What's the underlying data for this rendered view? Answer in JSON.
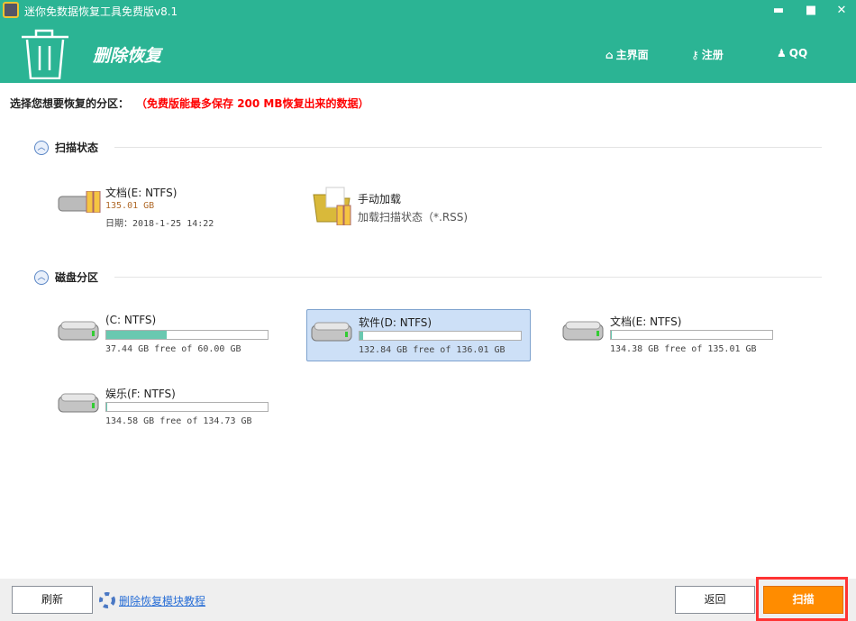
{
  "window": {
    "title": "迷你免数据恢复工具免费版v8.1",
    "minimize": "▬",
    "maximize": "■",
    "close": "✕"
  },
  "header": {
    "module_title": "删除恢复",
    "nav": [
      {
        "icon": "home-icon",
        "glyph": "⌂",
        "label": "主界面"
      },
      {
        "icon": "key-icon",
        "glyph": "⚷",
        "label": "注册"
      },
      {
        "icon": "qq-icon",
        "glyph": "♟",
        "label": "QQ"
      }
    ]
  },
  "prompt": {
    "label": "选择您想要恢复的分区：",
    "notice": "（免费版能最多保存 200 MB恢复出来的数据）"
  },
  "scan_state": {
    "title": "扫描状态",
    "items": [
      {
        "name": "文档(E: NTFS)",
        "size": "135.01 GB",
        "date": "日期：2018-1-25 14:22"
      },
      {
        "name": "手动加载",
        "desc": "加载扫描状态（*.RSS)"
      }
    ]
  },
  "partitions": {
    "title": "磁盘分区",
    "items": [
      {
        "name": "(C: NTFS)",
        "free": "37.44 GB free of 60.00 GB",
        "used_percent": 37.6
      },
      {
        "name": "软件(D: NTFS)",
        "free": "132.84 GB free of 136.01 GB",
        "used_percent": 2.3,
        "selected": true
      },
      {
        "name": "文档(E: NTFS)",
        "free": "134.38 GB free of 135.01 GB",
        "used_percent": 0.5
      },
      {
        "name": "娱乐(F: NTFS)",
        "free": "134.58 GB free of 134.73 GB",
        "used_percent": 0.1
      }
    ]
  },
  "footer": {
    "refresh": "刷新",
    "tutorial": "删除恢复模块教程",
    "back": "返回",
    "scan": "扫描"
  },
  "colors": {
    "header": "#2bb494",
    "accent": "#ff8c00",
    "notice": "#ff0000"
  }
}
